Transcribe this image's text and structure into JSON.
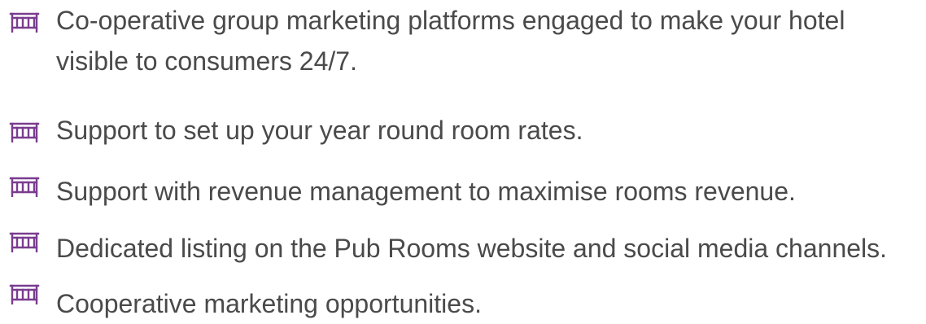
{
  "icon": {
    "name": "bed-icon",
    "color": "#7a3d8f"
  },
  "benefits": [
    {
      "text": "Co-operative group marketing platforms engaged to make your hotel visible to consumers 24/7."
    },
    {
      "text": "Support to set up your year round room rates."
    },
    {
      "text": "Support with revenue management to maximise rooms revenue."
    },
    {
      "text": "Dedicated listing on the Pub Rooms website and social media channels."
    },
    {
      "text": "Cooperative marketing opportunities."
    }
  ]
}
